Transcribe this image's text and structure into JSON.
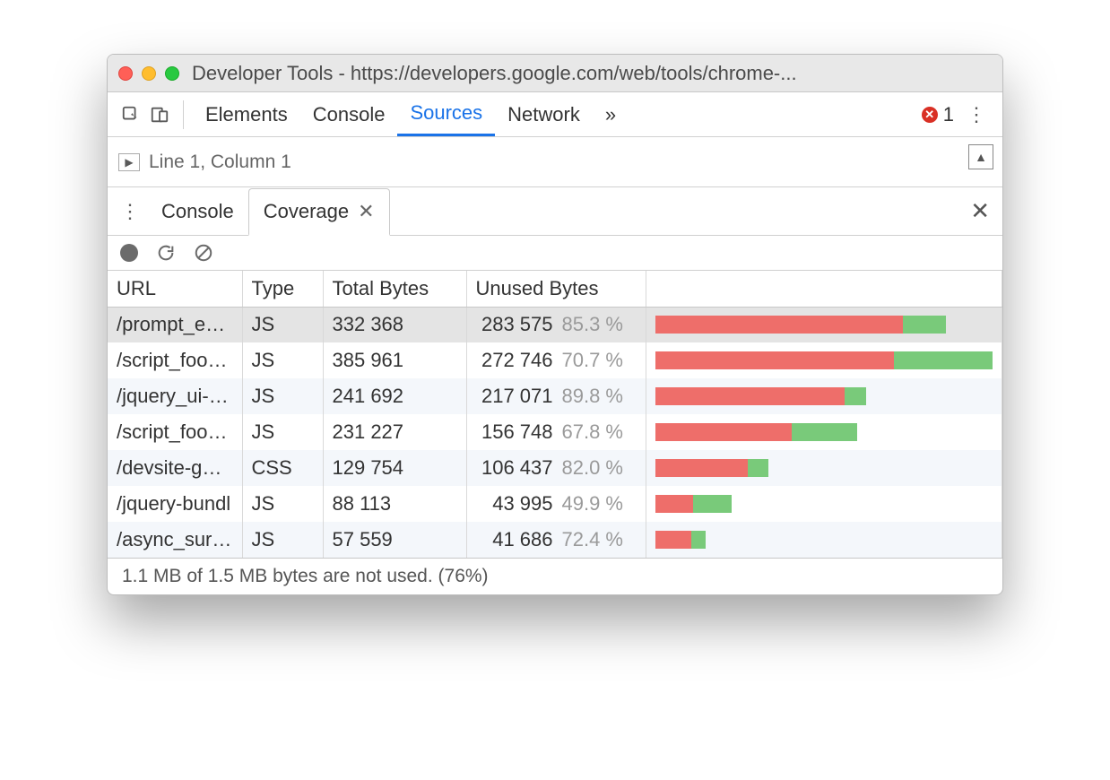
{
  "window": {
    "title": "Developer Tools - https://developers.google.com/web/tools/chrome-..."
  },
  "tabs": {
    "items": [
      "Elements",
      "Console",
      "Sources",
      "Network"
    ],
    "overflow_glyph": "»",
    "error_count": "1"
  },
  "editor": {
    "position": "Line 1, Column 1"
  },
  "drawer": {
    "console_label": "Console",
    "coverage_label": "Coverage"
  },
  "table": {
    "headers": {
      "url": "URL",
      "type": "Type",
      "total": "Total Bytes",
      "unused": "Unused Bytes"
    },
    "max_total": 385961,
    "rows": [
      {
        "url": "/prompt_emb",
        "type": "JS",
        "total": "332 368",
        "unused": "283 575",
        "pct": "85.3 %",
        "total_n": 332368,
        "unused_n": 283575,
        "selected": true
      },
      {
        "url": "/script_foot_c",
        "type": "JS",
        "total": "385 961",
        "unused": "272 746",
        "pct": "70.7 %",
        "total_n": 385961,
        "unused_n": 272746
      },
      {
        "url": "/jquery_ui-bun",
        "type": "JS",
        "total": "241 692",
        "unused": "217 071",
        "pct": "89.8 %",
        "total_n": 241692,
        "unused_n": 217071
      },
      {
        "url": "/script_foot.js",
        "type": "JS",
        "total": "231 227",
        "unused": "156 748",
        "pct": "67.8 %",
        "total_n": 231227,
        "unused_n": 156748
      },
      {
        "url": "/devsite-goog",
        "type": "CSS",
        "total": "129 754",
        "unused": "106 437",
        "pct": "82.0 %",
        "total_n": 129754,
        "unused_n": 106437
      },
      {
        "url": "/jquery-bundl",
        "type": "JS",
        "total": "88 113",
        "unused": "43 995",
        "pct": "49.9 %",
        "total_n": 88113,
        "unused_n": 43995
      },
      {
        "url": "/async_survey",
        "type": "JS",
        "total": "57 559",
        "unused": "41 686",
        "pct": "72.4 %",
        "total_n": 57559,
        "unused_n": 41686
      }
    ]
  },
  "status": {
    "text": "1.1 MB of 1.5 MB bytes are not used. (76%)"
  }
}
